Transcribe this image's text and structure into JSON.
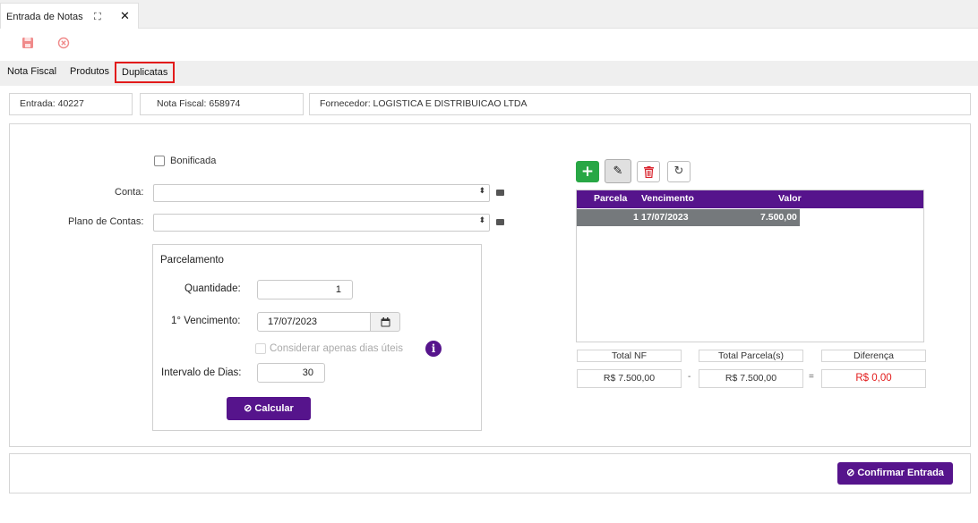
{
  "window_tab": {
    "title": "Entrada de Notas"
  },
  "section_tabs": [
    "Nota Fiscal",
    "Produtos",
    "Duplicatas"
  ],
  "header": {
    "entrada_label": "Entrada:",
    "entrada_value": "40227",
    "nota_label": "Nota Fiscal:",
    "nota_value": "658974",
    "fornecedor_label": "Fornecedor:",
    "fornecedor_value": "LOGISTICA E DISTRIBUICAO LTDA"
  },
  "form": {
    "bonificada_label": "Bonificada",
    "conta_label": "Conta:",
    "plano_label": "Plano de Contas:",
    "conta_value": "",
    "plano_value": ""
  },
  "parcelamento": {
    "title": "Parcelamento",
    "quantidade_label": "Quantidade:",
    "quantidade_value": "1",
    "vencimento_label": "1° Vencimento:",
    "vencimento_value": "17/07/2023",
    "dias_uteis_label": "Considerar apenas dias úteis",
    "intervalo_label": "Intervalo de Dias:",
    "intervalo_value": "30",
    "calcular_label": "Calcular"
  },
  "grid": {
    "columns": [
      "Parcela",
      "Vencimento",
      "Valor"
    ],
    "rows": [
      {
        "parcela": "1",
        "vencimento": "17/07/2023",
        "valor": "7.500,00"
      }
    ]
  },
  "totals": {
    "total_nf_label": "Total NF",
    "total_nf_value": "R$ 7.500,00",
    "total_parcelas_label": "Total Parcela(s)",
    "total_parcelas_value": "R$ 7.500,00",
    "diferenca_label": "Diferença",
    "diferenca_value": "R$ 0,00",
    "minus": "-",
    "equals": "="
  },
  "footer": {
    "confirmar_label": "Confirmar Entrada"
  },
  "colors": {
    "primary": "#56148c",
    "danger": "#e21b1b",
    "success": "#28a745",
    "row_selected": "#75797c"
  }
}
